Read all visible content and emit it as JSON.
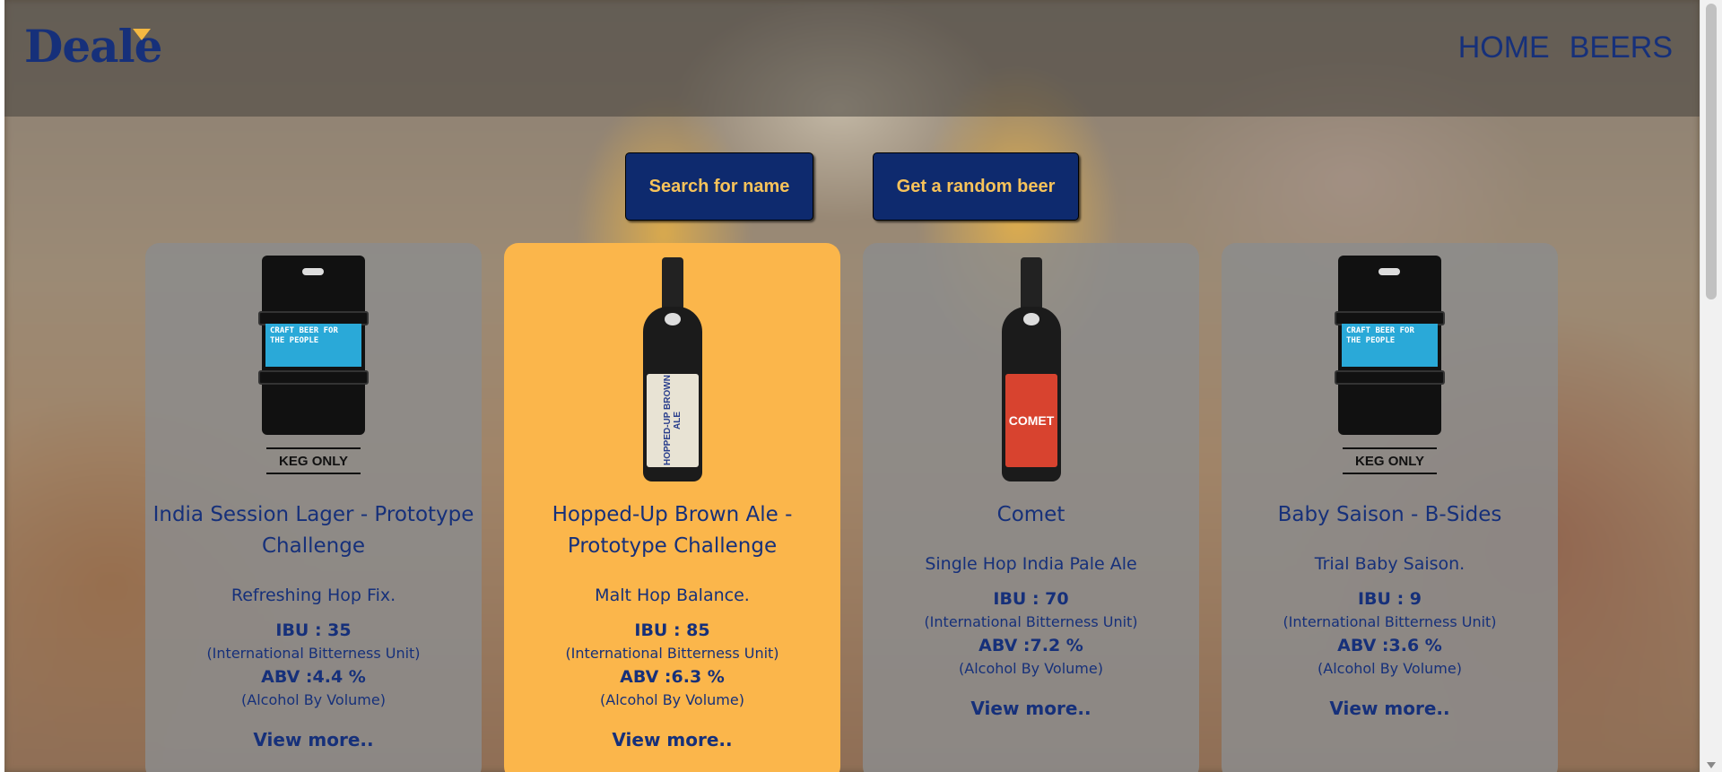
{
  "header": {
    "logo": "Deale",
    "nav": [
      "HOME",
      "BEERS"
    ]
  },
  "actions": {
    "search_label": "Search for name",
    "random_label": "Get a random beer"
  },
  "colors": {
    "brand_navy": "#16307a",
    "button_bg": "#0e2a6e",
    "accent_gold": "#f7c35a",
    "card_highlight": "#fbb64b",
    "card_bg": "#8c8c8c"
  },
  "beers": [
    {
      "name": "India Session Lager - Prototype Challenge",
      "tagline": "Refreshing Hop Fix.",
      "ibu": "IBU : 35",
      "ibu_note": "(International Bitterness Unit)",
      "abv": "ABV :4.4 %",
      "abv_note": "(Alcohol By Volume)",
      "more": "View more..",
      "image": "keg-icon",
      "keg_label": "CRAFT BEER FOR THE PEOPLE",
      "keg_tag": "KEG ONLY"
    },
    {
      "name": "Hopped-Up Brown Ale - Prototype Challenge",
      "tagline": "Malt Hop Balance.",
      "ibu": "IBU : 85",
      "ibu_note": "(International Bitterness Unit)",
      "abv": "ABV :6.3 %",
      "abv_note": "(Alcohol By Volume)",
      "more": "View more..",
      "image": "bottle-icon",
      "bottle_label": "HOPPED-UP BROWN ALE"
    },
    {
      "name": "Comet",
      "tagline": "Single Hop India Pale Ale",
      "ibu": "IBU : 70",
      "ibu_note": "(International Bitterness Unit)",
      "abv": "ABV :7.2 %",
      "abv_note": "(Alcohol By Volume)",
      "more": "View more..",
      "image": "bottle-icon",
      "bottle_label": "COMET"
    },
    {
      "name": "Baby Saison - B-Sides",
      "tagline": "Trial Baby Saison.",
      "ibu": "IBU : 9",
      "ibu_note": "(International Bitterness Unit)",
      "abv": "ABV :3.6 %",
      "abv_note": "(Alcohol By Volume)",
      "more": "View more..",
      "image": "keg-icon",
      "keg_label": "CRAFT BEER FOR THE PEOPLE",
      "keg_tag": "KEG ONLY"
    }
  ]
}
